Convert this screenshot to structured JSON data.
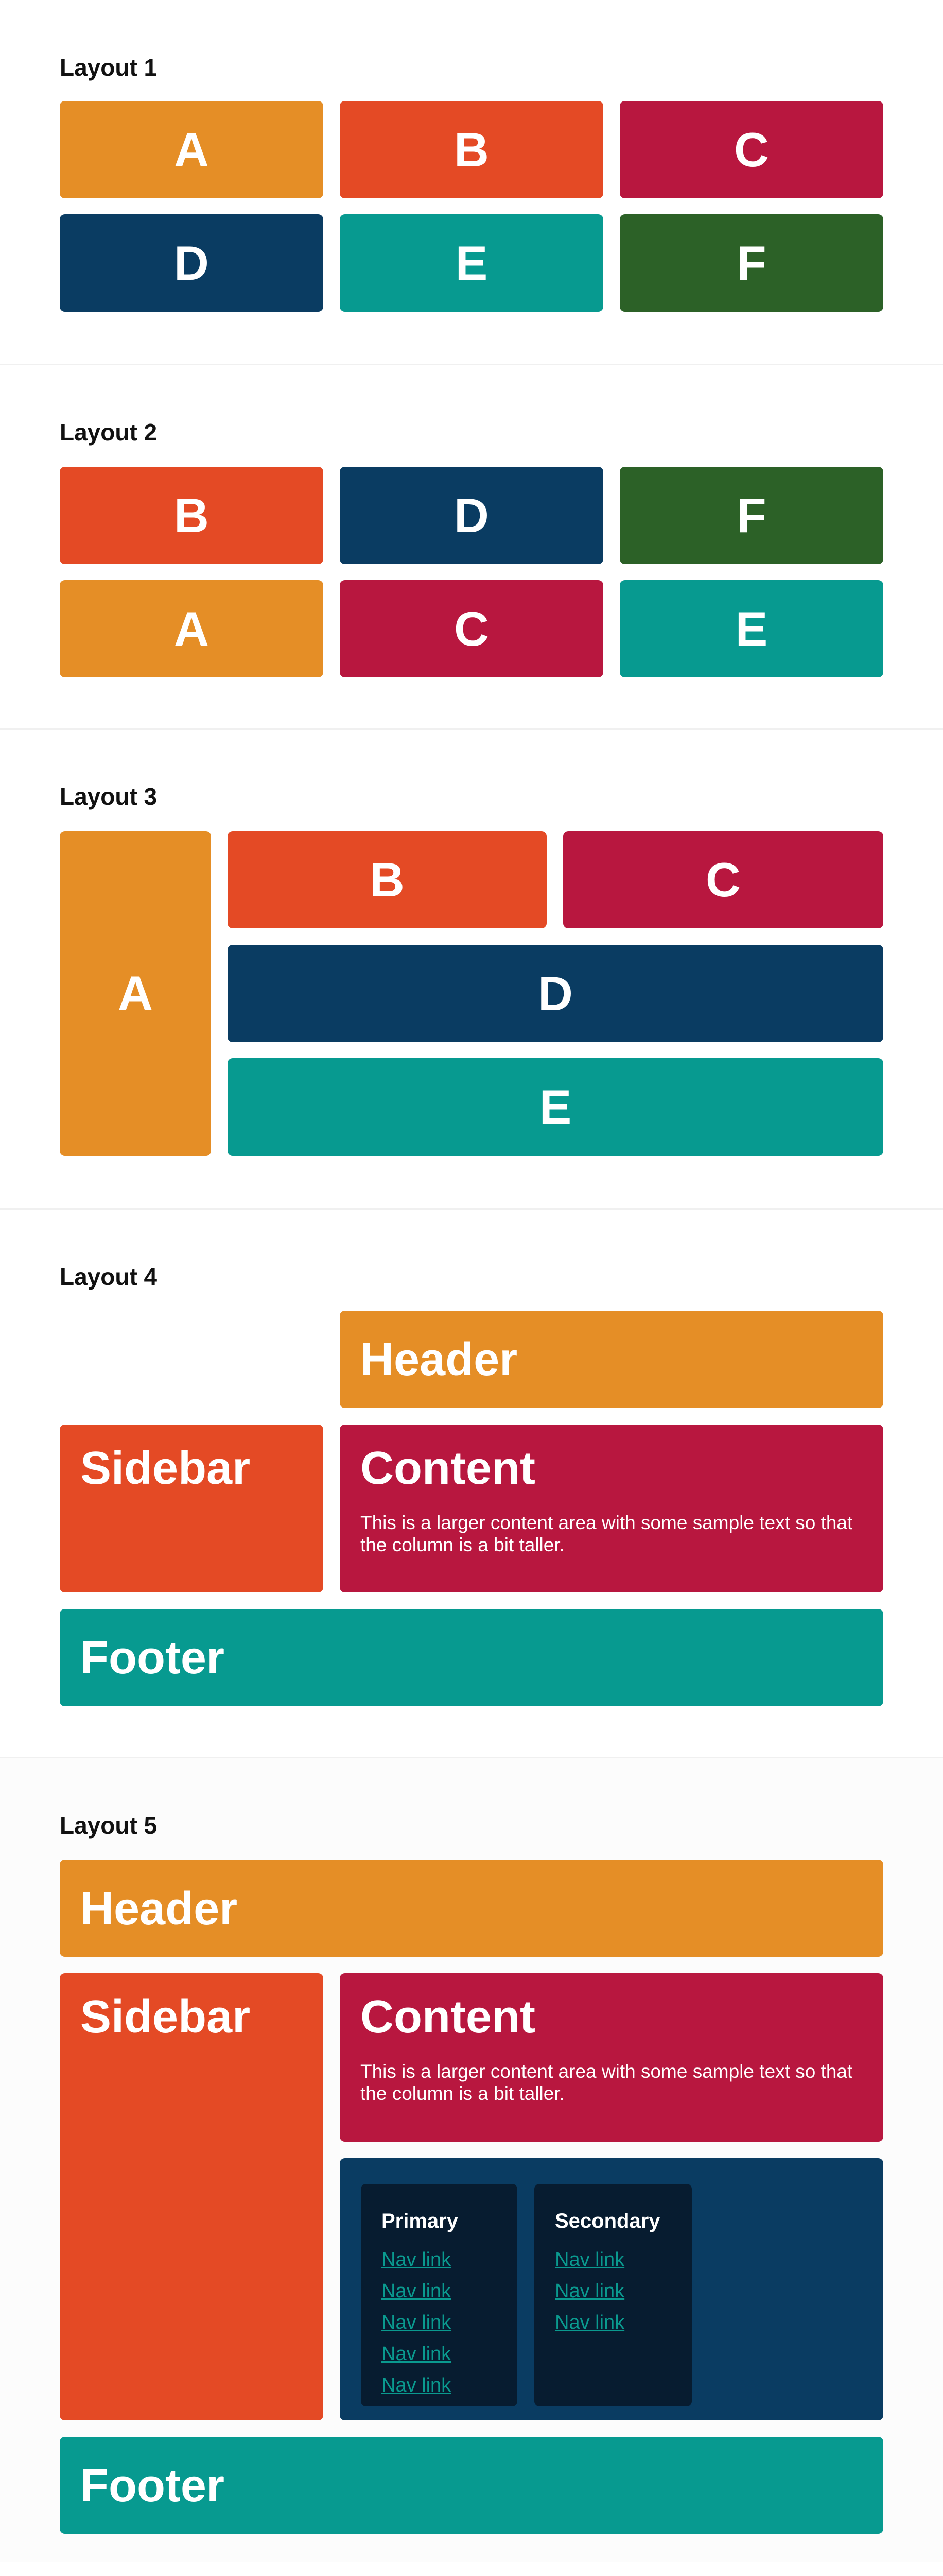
{
  "colors": {
    "orange": "#e58e26",
    "red": "#e44a25",
    "crimson": "#b8173f",
    "navy": "#0a3c62",
    "teal": "#079a90",
    "green": "#2c6127",
    "nav_card": "#071c30",
    "link": "#0a9a8f"
  },
  "layout1": {
    "title": "Layout 1",
    "items": [
      "A",
      "B",
      "C",
      "D",
      "E",
      "F"
    ]
  },
  "layout2": {
    "title": "Layout 2",
    "items": [
      "B",
      "D",
      "F",
      "A",
      "C",
      "E"
    ]
  },
  "layout3": {
    "title": "Layout 3",
    "items": [
      "A",
      "B",
      "C",
      "D",
      "E"
    ]
  },
  "layout4": {
    "title": "Layout 4",
    "header": "Header",
    "sidebar": "Sidebar",
    "content_title": "Content",
    "content_text": "This is a larger content area with some sample text so that the column is a bit taller.",
    "footer": "Footer"
  },
  "layout5": {
    "title": "Layout 5",
    "header": "Header",
    "sidebar": "Sidebar",
    "content_title": "Content",
    "content_text": "This is a larger content area with some sample text so that the column is a bit taller.",
    "footer": "Footer",
    "nav": [
      {
        "title": "Primary",
        "links": [
          "Nav link",
          "Nav link",
          "Nav link",
          "Nav link",
          "Nav link"
        ]
      },
      {
        "title": "Secondary",
        "links": [
          "Nav link",
          "Nav link",
          "Nav link"
        ]
      }
    ]
  }
}
